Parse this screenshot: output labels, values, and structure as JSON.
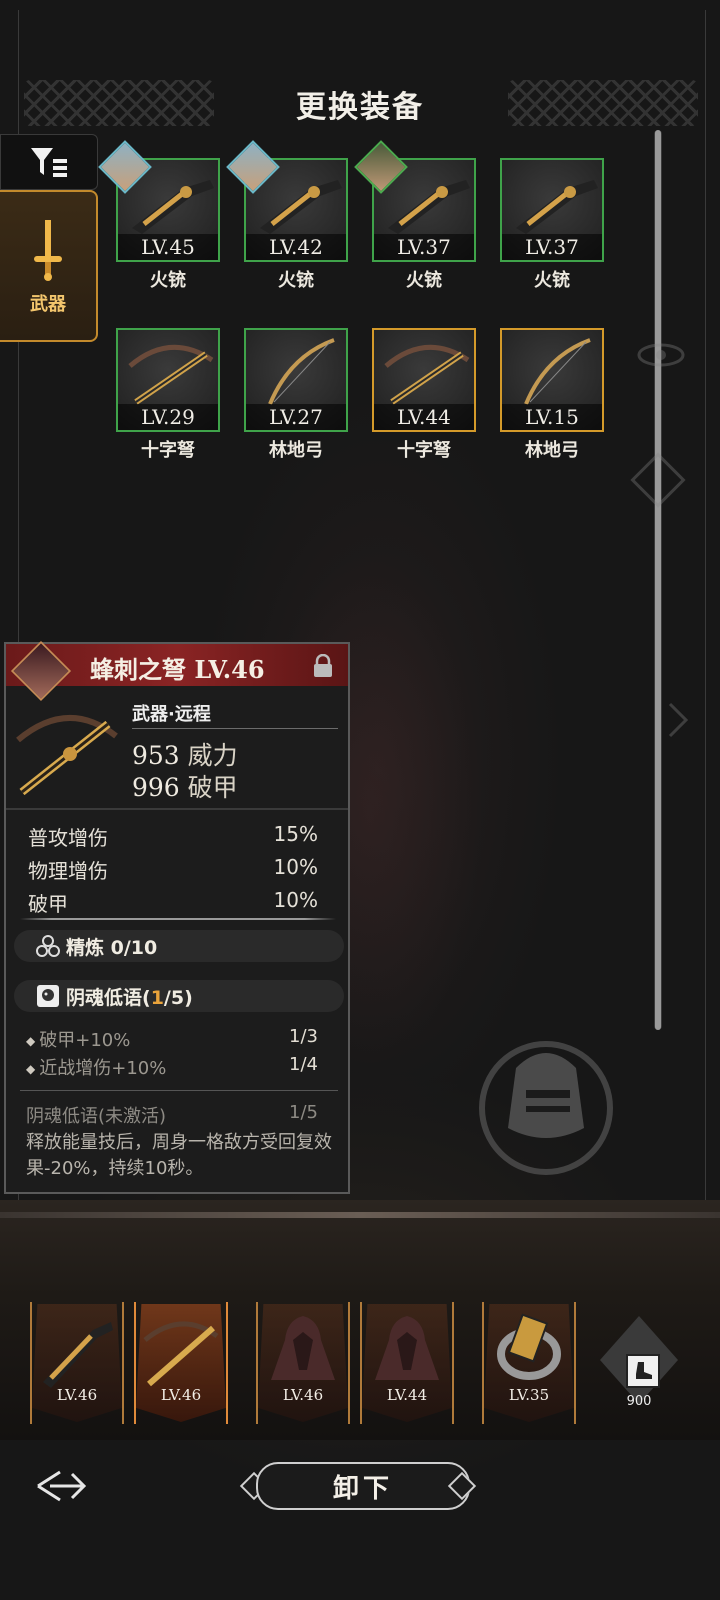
{
  "title": "更换装备",
  "filter": {
    "tab_label": "武器"
  },
  "items": [
    {
      "lv": "LV.45",
      "name": "火铳",
      "avatar": true
    },
    {
      "lv": "LV.42",
      "name": "火铳",
      "avatar": true
    },
    {
      "lv": "LV.37",
      "name": "火铳",
      "avatar": true
    },
    {
      "lv": "LV.37",
      "name": "火铳",
      "avatar": false
    },
    {
      "lv": "LV.29",
      "name": "十字弩",
      "avatar": false
    },
    {
      "lv": "LV.27",
      "name": "林地弓",
      "avatar": false
    },
    {
      "lv": "LV.44",
      "name": "十字弩",
      "avatar": false
    },
    {
      "lv": "LV.15",
      "name": "林地弓",
      "avatar": false
    }
  ],
  "detail": {
    "name": "蜂刺之弩 LV.46",
    "type": "武器·远程",
    "power_value": "953",
    "power_label": "威力",
    "armor_value": "996",
    "armor_label": "破甲",
    "attrs": [
      {
        "label": "普攻增伤",
        "value": "15%"
      },
      {
        "label": "物理增伤",
        "value": "10%"
      },
      {
        "label": "破甲",
        "value": "10%"
      }
    ],
    "refine": "精炼 0/10",
    "set_name": "阴魂低语(",
    "set_progress": "1",
    "set_total": "/5)",
    "set_bonuses": [
      {
        "label": "破甲+10%",
        "value": "1/3"
      },
      {
        "label": "近战增伤+10%",
        "value": "1/4"
      }
    ],
    "inactive_title": "阴魂低语(未激活)",
    "inactive_value": "1/5",
    "description": "释放能量技后，周身一格敌方受回复效果-20%，持续10秒。"
  },
  "equipped": [
    {
      "lv": "LV.46",
      "icon": "musket-icon"
    },
    {
      "lv": "LV.46",
      "icon": "crossbow-icon"
    },
    {
      "lv": "LV.46",
      "icon": "cloak-icon"
    },
    {
      "lv": "LV.44",
      "icon": "cloak-icon"
    },
    {
      "lv": "LV.35",
      "icon": "ring-icon"
    }
  ],
  "boot_value": "900",
  "unequip_label": "卸下",
  "colors": {
    "green_border": "#3fa34a",
    "gold_border": "#d49a2a",
    "header_red": "#8a2424",
    "accent_orange": "#e9a33b"
  }
}
